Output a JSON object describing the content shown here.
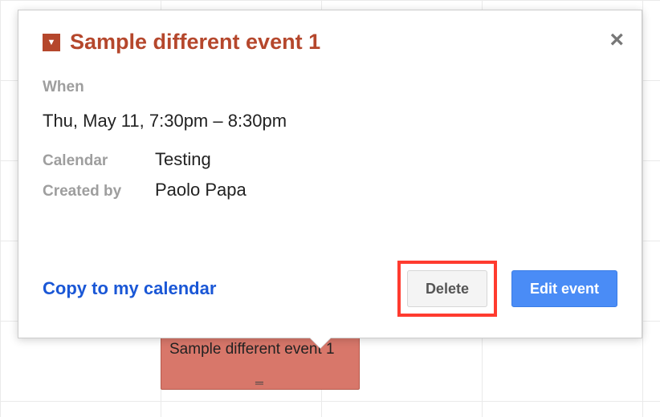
{
  "event": {
    "title": "Sample different event 1",
    "when_label": "When",
    "when_value": "Thu, May 11, 7:30pm – 8:30pm",
    "calendar_label": "Calendar",
    "calendar_value": "Testing",
    "created_by_label": "Created by",
    "created_by_value": "Paolo Papa"
  },
  "actions": {
    "copy_link": "Copy to my calendar",
    "delete": "Delete",
    "edit": "Edit event"
  },
  "grid_event": {
    "title": "Sample different event 1"
  }
}
